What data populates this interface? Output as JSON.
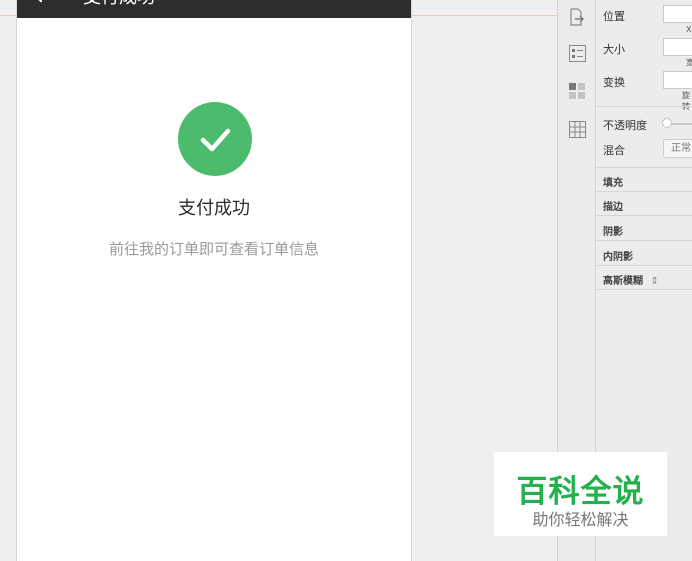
{
  "artboard": {
    "nav_title": "支付成功",
    "success_title": "支付成功",
    "success_subtitle": "前往我的订单即可查看订单信息"
  },
  "inspector": {
    "position_label": "位置",
    "position_sub": "X",
    "size_label": "大小",
    "size_sub": "宽",
    "transform_label": "变换",
    "transform_sub": "旋转",
    "opacity_label": "不透明度",
    "blend_label": "混合",
    "blend_value": "正常",
    "sections": [
      "填充",
      "描边",
      "阴影",
      "内阴影",
      "高斯模糊"
    ]
  },
  "toolbar": {
    "icons": [
      "export-icon",
      "layer-list-icon",
      "grid-tiles-icon",
      "table-icon"
    ]
  },
  "watermark": {
    "title": "百科全说",
    "subtitle": "助你轻松解决"
  },
  "colors": {
    "success": "#4dbb6e",
    "navbar": "#2d2d2d",
    "watermark_green": "#23b14d"
  }
}
